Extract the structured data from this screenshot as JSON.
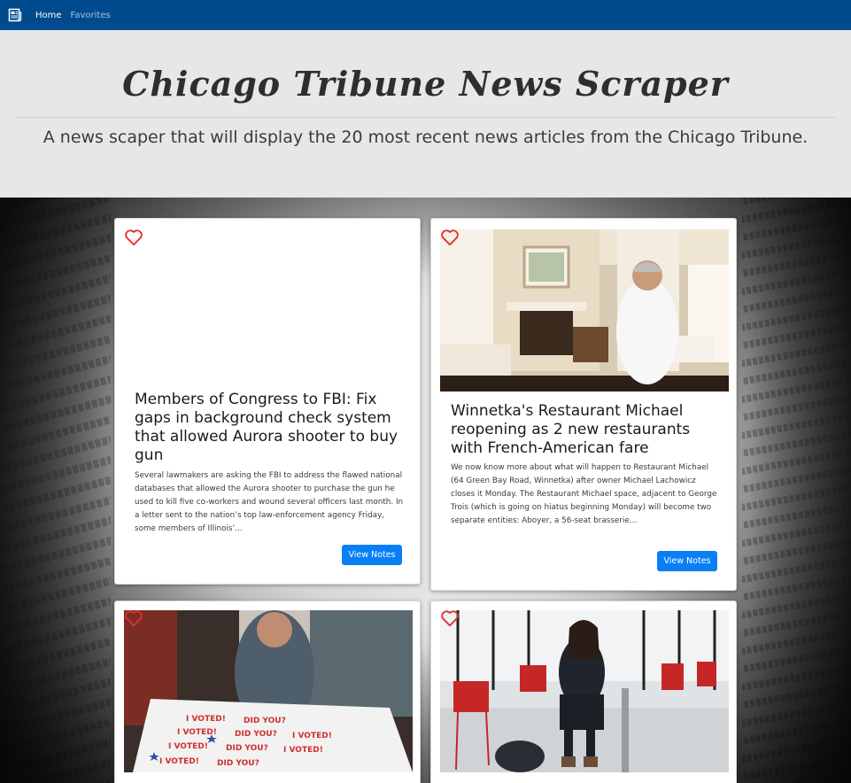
{
  "nav": {
    "brand_icon": "newspaper-icon",
    "links": [
      {
        "label": "Home",
        "active": true
      },
      {
        "label": "Favorites",
        "active": false
      }
    ]
  },
  "header": {
    "title": "Chicago Tribune News Scraper",
    "subtitle": "A news scaper that will display the 20 most recent news articles from the Chicago Tribune."
  },
  "articles": [
    {
      "title": "Members of Congress to FBI: Fix gaps in background check system that allowed Aurora shooter to buy gun",
      "summary": "Several lawmakers are asking the FBI to address the flawed national databases that allowed the Aurora shooter to purchase the gun he used to kill five co-workers and wound several officers last month. In a letter sent to the nation’s top law-enforcement agency Friday, some members of Illinois’...",
      "button": "View Notes",
      "favorite_icon": "heart-outline-icon"
    },
    {
      "title": "Winnetka's Restaurant Michael reopening as 2 new restaurants with French-American fare",
      "summary": "We now know more about what will happen to Restaurant Michael (64 Green Bay Road, Winnetka) after owner Michael Lachowicz closes it Monday. The Restaurant Michael space, adjacent to George Trois (which is going on hiatus beginning Monday) will become two separate entities: Aboyer, a 56-seat brasserie...",
      "button": "View Notes",
      "favorite_icon": "heart-outline-icon"
    },
    {
      "favorite_icon": "heart-outline-icon"
    },
    {
      "favorite_icon": "heart-outline-icon"
    }
  ],
  "colors": {
    "navbar": "#004b8d",
    "jumbotron": "#e7e7e7",
    "button": "#0a7ff5",
    "heart": "#e0302c"
  }
}
